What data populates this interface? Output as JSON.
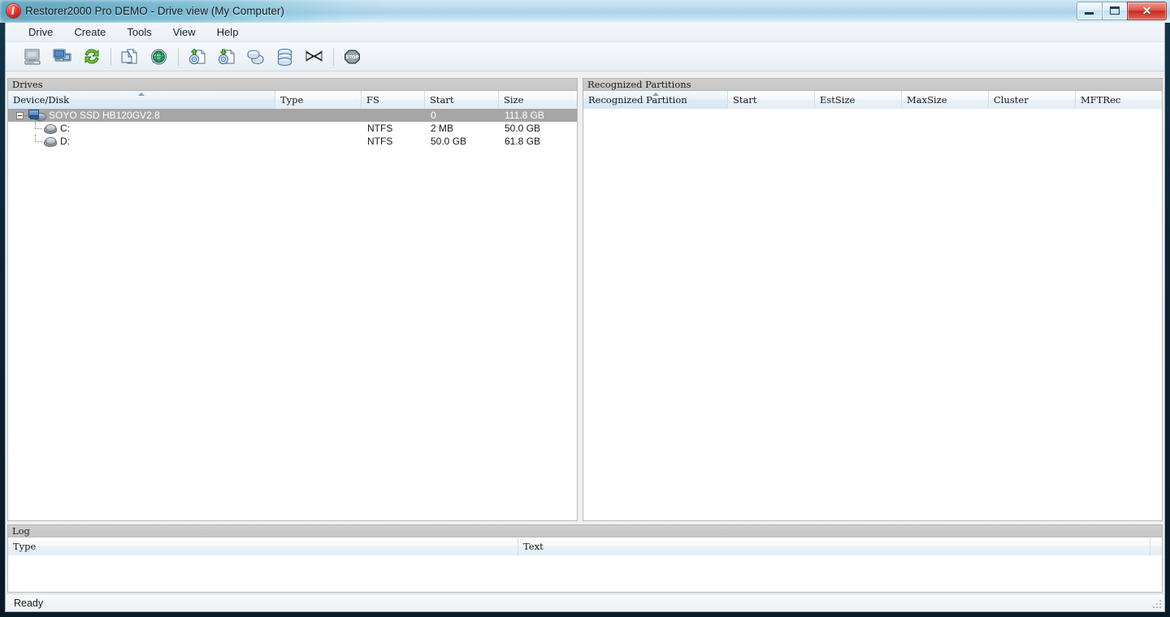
{
  "window": {
    "title": "Restorer2000 Pro DEMO - Drive view (My Computer)",
    "app_icon": "restorer-logo-icon",
    "controls": {
      "minimize": "minimize-icon",
      "maximize": "maximize-icon",
      "close": "close-icon"
    }
  },
  "menu": {
    "items": [
      {
        "label": "Drive"
      },
      {
        "label": "Create"
      },
      {
        "label": "Tools"
      },
      {
        "label": "View"
      },
      {
        "label": "Help"
      }
    ]
  },
  "toolbar": {
    "groups": [
      {
        "buttons": [
          {
            "name": "my-computer-icon",
            "tooltip": "My Computer"
          },
          {
            "name": "network-computers-icon",
            "tooltip": "Network Computers"
          },
          {
            "name": "refresh-icon",
            "tooltip": "Refresh"
          }
        ]
      },
      {
        "buttons": [
          {
            "name": "copy-files-icon",
            "tooltip": "Copy Files"
          },
          {
            "name": "globe-scan-icon",
            "tooltip": "Scan"
          }
        ]
      },
      {
        "buttons": [
          {
            "name": "open-image-icon",
            "tooltip": "Open Image"
          },
          {
            "name": "save-image-icon",
            "tooltip": "Save Image"
          },
          {
            "name": "connect-drive-icon",
            "tooltip": "Connect Drive"
          },
          {
            "name": "disk-stack-icon",
            "tooltip": "Disk"
          },
          {
            "name": "disconnect-icon",
            "tooltip": "Disconnect"
          }
        ]
      },
      {
        "buttons": [
          {
            "name": "stop-icon",
            "tooltip": "Stop"
          }
        ]
      }
    ]
  },
  "drives_panel": {
    "caption": "Drives",
    "columns": [
      {
        "label": "Device/Disk",
        "sorted": true
      },
      {
        "label": "Type",
        "sorted": false
      },
      {
        "label": "FS",
        "sorted": false
      },
      {
        "label": "Start",
        "sorted": false
      },
      {
        "label": "Size",
        "sorted": false
      }
    ],
    "rows": [
      {
        "icon": "physical-disk-icon",
        "indent": 0,
        "expanded": true,
        "selected": true,
        "device": "SOYO SSD HB120GV2.8",
        "type": "",
        "fs": "",
        "start": "0",
        "size": "111.8 GB"
      },
      {
        "icon": "logical-drive-icon",
        "indent": 1,
        "expanded": false,
        "selected": false,
        "device": "C:",
        "type": "",
        "fs": "NTFS",
        "start": "2 MB",
        "size": "50.0 GB"
      },
      {
        "icon": "logical-drive-icon",
        "indent": 1,
        "expanded": false,
        "selected": false,
        "device": "D:",
        "type": "",
        "fs": "NTFS",
        "start": "50.0 GB",
        "size": "61.8 GB"
      }
    ]
  },
  "partitions_panel": {
    "caption": "Recognized Partitions",
    "columns": [
      {
        "label": "Recognized Partition",
        "sorted": true
      },
      {
        "label": "Start",
        "sorted": false
      },
      {
        "label": "EstSize",
        "sorted": false
      },
      {
        "label": "MaxSize",
        "sorted": false
      },
      {
        "label": "Cluster",
        "sorted": false
      },
      {
        "label": "MFTRec",
        "sorted": false
      }
    ],
    "rows": []
  },
  "log_panel": {
    "caption": "Log",
    "columns": [
      {
        "label": "Type"
      },
      {
        "label": "Text"
      }
    ],
    "rows": []
  },
  "statusbar": {
    "text": "Ready"
  }
}
